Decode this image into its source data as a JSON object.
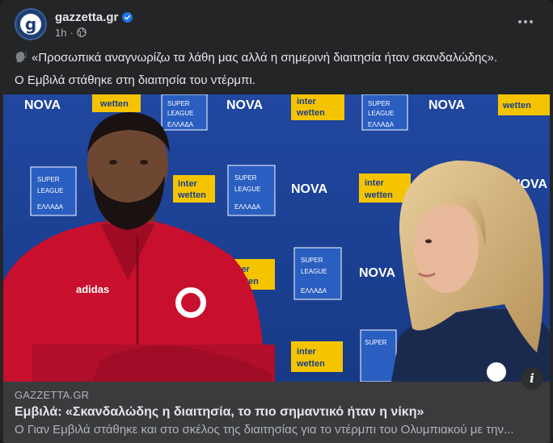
{
  "post": {
    "page_name": "gazzetta.gr",
    "avatar_letter": "g",
    "time": "1h",
    "separator": "·",
    "quote_text": "«Προσωπικά αναγνωρίζω τα λάθη μας αλλά η σημερινή διαιτησία ήταν σκανδαλώδης».",
    "body_text": "Ο Εμβιλά στάθηκε στη διαιτησία του ντέρμπι."
  },
  "media": {
    "sponsor_nova": "NOVA",
    "sponsor_inter": "inter",
    "sponsor_wetten": "wetten",
    "league_super": "SUPER",
    "league_league": "LEAGUE",
    "league_country": "ΕΛΛΑΔΑ",
    "shirt_brand": "adidas"
  },
  "link_preview": {
    "domain": "GAZZETTA.GR",
    "headline": "Εμβιλά: «Σκανδαλώδης η διαιτησία, το πιο σημαντικό ήταν η νίκη»",
    "description": "Ο Γιαν Εμβιλά στάθηκε και στο σκέλος της διαιτησίας για το ντέρμπι του Ολυμπιακού με την...",
    "info_label": "i"
  },
  "colors": {
    "card_bg": "#242526",
    "link_bg": "#3a3b3c",
    "verified_blue": "#1b74e4",
    "backdrop_blue": "#1c3f8c",
    "sponsor_yellow": "#f5c400",
    "shirt_red": "#c8102e"
  },
  "icons": [
    "verified-badge-icon",
    "globe-icon",
    "more-options-icon",
    "speaking-head-icon",
    "info-icon"
  ]
}
